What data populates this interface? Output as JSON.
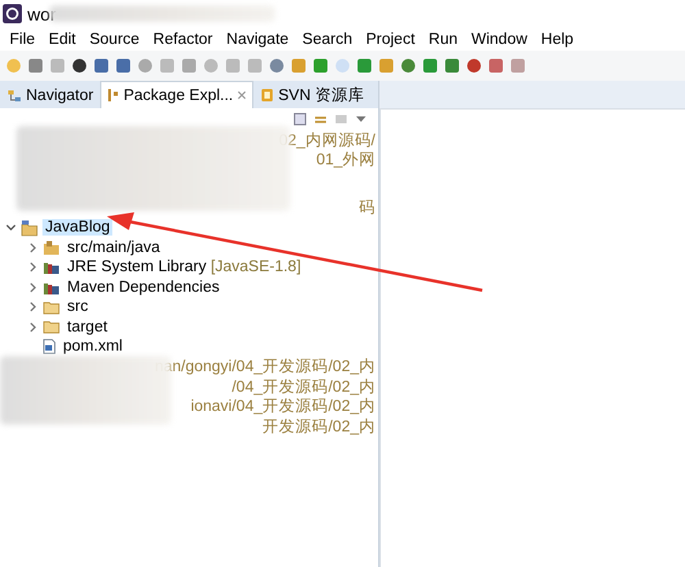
{
  "window": {
    "title": "wor"
  },
  "menu": [
    "File",
    "Edit",
    "Source",
    "Refactor",
    "Navigate",
    "Search",
    "Project",
    "Run",
    "Window",
    "Help"
  ],
  "tabs": [
    {
      "label": "Navigator",
      "selected": false,
      "kind": "navigator"
    },
    {
      "label": "Package Expl...",
      "selected": true,
      "kind": "package"
    },
    {
      "label": "SVN 资源库",
      "selected": false,
      "kind": "svn"
    }
  ],
  "blurred_rows_top": [
    {
      "text": "02_内网源码/"
    },
    {
      "text": "01_外网"
    },
    {
      "text": "码"
    }
  ],
  "tree": [
    {
      "label": "JavaBlog",
      "kind": "project",
      "expanded": true,
      "selected": true,
      "children": [
        {
          "label": "src/main/java",
          "kind": "source",
          "expanded": false
        },
        {
          "label": "JRE System Library",
          "decoration": "[JavaSE-1.8]",
          "kind": "library",
          "expanded": false
        },
        {
          "label": "Maven Dependencies",
          "kind": "library",
          "expanded": false
        },
        {
          "label": "src",
          "kind": "folder",
          "expanded": false
        },
        {
          "label": "target",
          "kind": "folder",
          "expanded": false
        },
        {
          "label": "pom.xml",
          "kind": "file"
        }
      ]
    }
  ],
  "blurred_rows_bottom": [
    {
      "text": "nan/gongyi/04_开发源码/02_内"
    },
    {
      "text": "/04_开发源码/02_内"
    },
    {
      "text": "ionavi/04_开发源码/02_内"
    },
    {
      "text": "开发源码/02_内"
    }
  ]
}
